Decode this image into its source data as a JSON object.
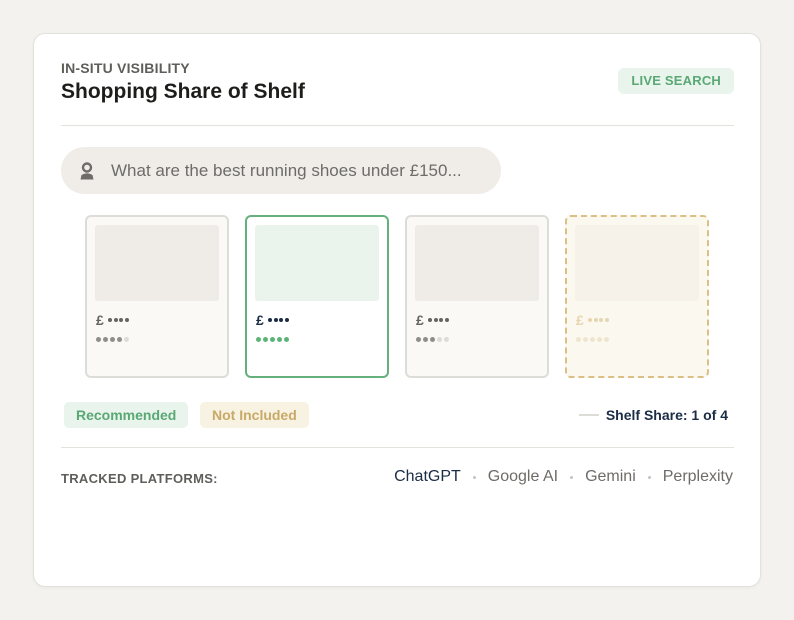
{
  "header": {
    "eyebrow": "IN-SITU VISIBILITY",
    "title": "Shopping Share of Shelf",
    "badge": "LIVE SEARCH"
  },
  "search": {
    "query": "What are the best running shoes under £150..."
  },
  "products": [
    {
      "status": "neutral",
      "currency": "£",
      "rating": 4,
      "rating_max": 5
    },
    {
      "status": "recommended",
      "currency": "£",
      "rating": 5,
      "rating_max": 5
    },
    {
      "status": "neutral",
      "currency": "£",
      "rating": 3,
      "rating_max": 5
    },
    {
      "status": "not-included",
      "currency": "£",
      "rating": 5,
      "rating_max": 5
    }
  ],
  "legend": {
    "recommended": "Recommended",
    "not_included": "Not Included"
  },
  "shelf_share": {
    "text": "Shelf Share: 1 of 4"
  },
  "tracked": {
    "label": "TRACKED PLATFORMS:",
    "platforms": [
      "ChatGPT",
      "Google AI",
      "Gemini",
      "Perplexity"
    ],
    "active": "ChatGPT"
  },
  "colors": {
    "accent_green": "#66b07e",
    "not_included_gold": "#dcbf85",
    "navy": "#1b2c45"
  }
}
